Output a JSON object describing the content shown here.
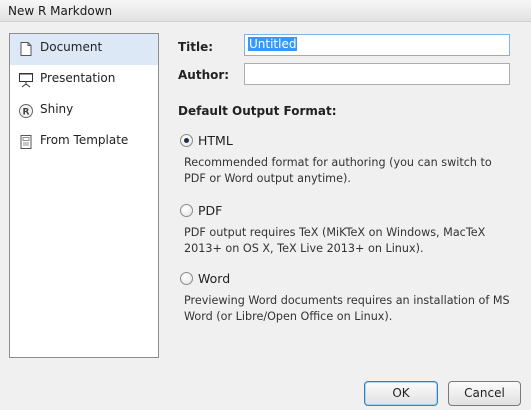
{
  "window": {
    "title": "New R Markdown"
  },
  "sidebar": {
    "items": [
      {
        "label": "Document",
        "icon": "document-icon",
        "selected": true
      },
      {
        "label": "Presentation",
        "icon": "presentation-icon",
        "selected": false
      },
      {
        "label": "Shiny",
        "icon": "shiny-r-icon",
        "selected": false
      },
      {
        "label": "From Template",
        "icon": "template-icon",
        "selected": false
      }
    ]
  },
  "form": {
    "title_label": "Title:",
    "title_value": "Untitled",
    "author_label": "Author:",
    "author_value": ""
  },
  "output": {
    "heading": "Default Output Format:",
    "options": [
      {
        "label": "HTML",
        "selected": true,
        "description": "Recommended format for authoring (you can switch to PDF or Word output anytime)."
      },
      {
        "label": "PDF",
        "selected": false,
        "description": "PDF output requires TeX (MiKTeX on Windows, MacTeX 2013+ on OS X, TeX Live 2013+ on Linux)."
      },
      {
        "label": "Word",
        "selected": false,
        "description": "Previewing Word documents requires an installation of MS Word (or Libre/Open Office on Linux)."
      }
    ]
  },
  "buttons": {
    "ok": "OK",
    "cancel": "Cancel"
  }
}
